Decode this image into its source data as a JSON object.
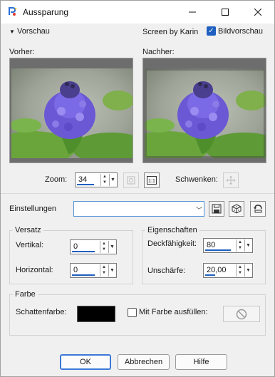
{
  "window": {
    "title": "Aussparung",
    "minimize_icon": "minimize-icon",
    "maximize_icon": "maximize-icon",
    "close_icon": "close-icon"
  },
  "top": {
    "vorschau_label": "Vorschau",
    "screen_by": "Screen by Karin",
    "bildvorschau_label": "Bildvorschau",
    "bildvorschau_checked": true
  },
  "preview": {
    "vorher_label": "Vorher:",
    "nachher_label": "Nachher:"
  },
  "zoom": {
    "label": "Zoom:",
    "value": "34",
    "schwenken_label": "Schwenken:"
  },
  "einstellungen": {
    "label": "Einstellungen",
    "value": ""
  },
  "versatz": {
    "title": "Versatz",
    "vertikal_label": "Vertikal:",
    "vertikal_value": "0",
    "horizontal_label": "Horizontal:",
    "horizontal_value": "0"
  },
  "eigenschaften": {
    "title": "Eigenschaften",
    "deckfaehigkeit_label": "Deckfähigkeit:",
    "deckfaehigkeit_value": "80",
    "unschaerfe_label": "Unschärfe:",
    "unschaerfe_value": "20,00"
  },
  "farbe": {
    "title": "Farbe",
    "schattenfarbe_label": "Schattenfarbe:",
    "schattenfarbe_color": "#000000",
    "mit_farbe_label": "Mit Farbe ausfüllen:",
    "mit_farbe_checked": false
  },
  "buttons": {
    "ok": "OK",
    "abbrechen": "Abbrechen",
    "hilfe": "Hilfe"
  },
  "colors": {
    "accent": "#1f5fbf",
    "shadow_swatch": "#000000"
  }
}
